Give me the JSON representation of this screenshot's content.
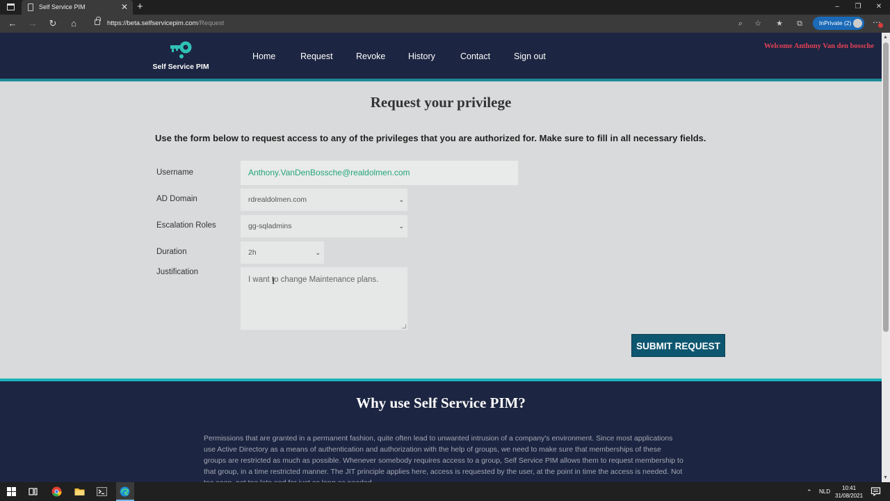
{
  "browser": {
    "tab_title": "Self Service PIM",
    "tab_close": "✕",
    "new_tab": "+",
    "url_host": "https://beta.selfservicepim.com",
    "url_path": "/Request",
    "inprivate_label": "InPrivate (2)",
    "window_controls": [
      "–",
      "❐",
      "✕"
    ]
  },
  "header": {
    "logo_text": "Self Service PIM",
    "nav": [
      "Home",
      "Request",
      "Revoke",
      "History",
      "Contact",
      "Sign out"
    ],
    "welcome": "Welcome Anthony Van den bossche"
  },
  "form": {
    "title": "Request your privilege",
    "intro": "Use the form below to request access to any of the privileges that you are authorized for. Make sure to fill in all necessary fields.",
    "username_label": "Username",
    "username_value": "Anthony.VanDenBossche@realdolmen.com",
    "domain_label": "AD Domain",
    "domain_value": "rdrealdolmen.com",
    "roles_label": "Escalation Roles",
    "roles_value": "gg-sqladmins",
    "duration_label": "Duration",
    "duration_value": "2h",
    "justification_label": "Justification",
    "justification_value": "I want to change Maintenance plans.",
    "submit_label": "SUBMIT REQUEST"
  },
  "why": {
    "title": "Why use Self Service PIM?",
    "text": "Permissions that are granted in a permanent fashion, quite often lead to unwanted intrusion of a company's environment. Since most applications use Active Directory as a means of authentication and authorization with the help of groups, we need to make sure that memberships of these groups are restricted as much as possible. Whenever somebody requires access to a group, Self Service PIM allows them to request membership to that group, in a time restricted manner. The JIT principle applies here, access is requested by the user, at the point in time the access is needed. Not too soon, not too late and for just as long as needed."
  },
  "taskbar": {
    "language": "NLD",
    "time": "10:41",
    "date": "31/08/2021"
  },
  "colors": {
    "header_bg": "#1c2541",
    "accent_teal": "#1e8a96",
    "welcome_red": "#e34256",
    "username_green": "#22a67a",
    "submit_bg": "#0d5670"
  }
}
